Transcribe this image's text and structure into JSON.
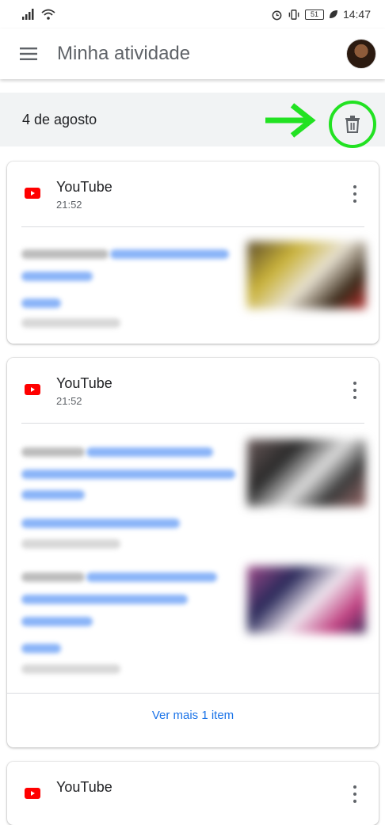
{
  "status_bar": {
    "time": "14:47",
    "battery": "51"
  },
  "app_bar": {
    "title": "Minha atividade"
  },
  "date_header": {
    "label": "4 de agosto"
  },
  "cards": [
    {
      "title": "YouTube",
      "time": "21:52"
    },
    {
      "title": "YouTube",
      "time": "21:52",
      "see_more": "Ver mais 1 item"
    },
    {
      "title": "YouTube"
    }
  ],
  "colors": {
    "highlight": "#22e222",
    "youtube_red": "#ff0000",
    "link_blue": "#1a73e8"
  }
}
